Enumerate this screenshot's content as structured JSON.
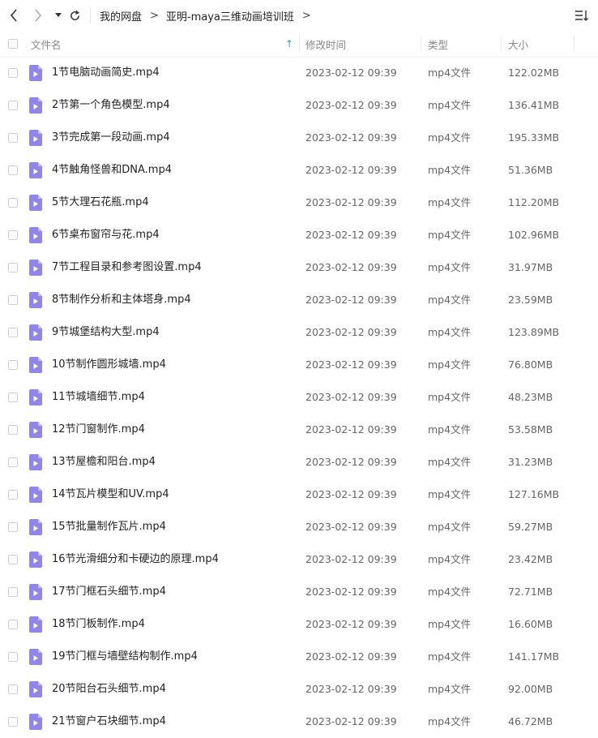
{
  "toolbar": {
    "back_icon": "chevron-left-icon",
    "forward_icon": "chevron-right-icon",
    "history_icon": "caret-down-icon",
    "refresh_icon": "refresh-icon",
    "sort_icon": "sort-list-icon",
    "breadcrumb": [
      "我的网盘",
      "亚明-maya三维动画培训班"
    ],
    "separator": ">"
  },
  "header": {
    "name": "文件名",
    "sort_arrow": "↑",
    "modified": "修改时间",
    "type": "类型",
    "size": "大小"
  },
  "accent_color": "#2aa3c9",
  "file_icon_color": "#8f86e8",
  "files": [
    {
      "name": "1节电脑动画简史.mp4",
      "modified": "2023-02-12 09:39",
      "type": "mp4文件",
      "size": "122.02MB"
    },
    {
      "name": "2节第一个角色模型.mp4",
      "modified": "2023-02-12 09:39",
      "type": "mp4文件",
      "size": "136.41MB"
    },
    {
      "name": "3节完成第一段动画.mp4",
      "modified": "2023-02-12 09:39",
      "type": "mp4文件",
      "size": "195.33MB"
    },
    {
      "name": "4节触角怪兽和DNA.mp4",
      "modified": "2023-02-12 09:39",
      "type": "mp4文件",
      "size": "51.36MB"
    },
    {
      "name": "5节大理石花瓶.mp4",
      "modified": "2023-02-12 09:39",
      "type": "mp4文件",
      "size": "112.20MB"
    },
    {
      "name": "6节桌布窗帘与花.mp4",
      "modified": "2023-02-12 09:39",
      "type": "mp4文件",
      "size": "102.96MB"
    },
    {
      "name": "7节工程目录和参考图设置.mp4",
      "modified": "2023-02-12 09:39",
      "type": "mp4文件",
      "size": "31.97MB"
    },
    {
      "name": "8节制作分析和主体塔身.mp4",
      "modified": "2023-02-12 09:39",
      "type": "mp4文件",
      "size": "23.59MB"
    },
    {
      "name": "9节城堡结构大型.mp4",
      "modified": "2023-02-12 09:39",
      "type": "mp4文件",
      "size": "123.89MB"
    },
    {
      "name": "10节制作圆形城墙.mp4",
      "modified": "2023-02-12 09:39",
      "type": "mp4文件",
      "size": "76.80MB"
    },
    {
      "name": "11节城墙细节.mp4",
      "modified": "2023-02-12 09:39",
      "type": "mp4文件",
      "size": "48.23MB"
    },
    {
      "name": "12节门窗制作.mp4",
      "modified": "2023-02-12 09:39",
      "type": "mp4文件",
      "size": "53.58MB"
    },
    {
      "name": "13节屋檐和阳台.mp4",
      "modified": "2023-02-12 09:39",
      "type": "mp4文件",
      "size": "31.23MB"
    },
    {
      "name": "14节瓦片模型和UV.mp4",
      "modified": "2023-02-12 09:39",
      "type": "mp4文件",
      "size": "127.16MB"
    },
    {
      "name": "15节批量制作瓦片.mp4",
      "modified": "2023-02-12 09:39",
      "type": "mp4文件",
      "size": "59.27MB"
    },
    {
      "name": "16节光滑细分和卡硬边的原理.mp4",
      "modified": "2023-02-12 09:39",
      "type": "mp4文件",
      "size": "23.42MB"
    },
    {
      "name": "17节门框石头细节.mp4",
      "modified": "2023-02-12 09:39",
      "type": "mp4文件",
      "size": "72.71MB"
    },
    {
      "name": "18节门板制作.mp4",
      "modified": "2023-02-12 09:39",
      "type": "mp4文件",
      "size": "16.60MB"
    },
    {
      "name": "19节门框与墙壁结构制作.mp4",
      "modified": "2023-02-12 09:39",
      "type": "mp4文件",
      "size": "141.17MB"
    },
    {
      "name": "20节阳台石头细节.mp4",
      "modified": "2023-02-12 09:39",
      "type": "mp4文件",
      "size": "92.00MB"
    },
    {
      "name": "21节窗户石块细节.mp4",
      "modified": "2023-02-12 09:39",
      "type": "mp4文件",
      "size": "46.72MB"
    }
  ]
}
